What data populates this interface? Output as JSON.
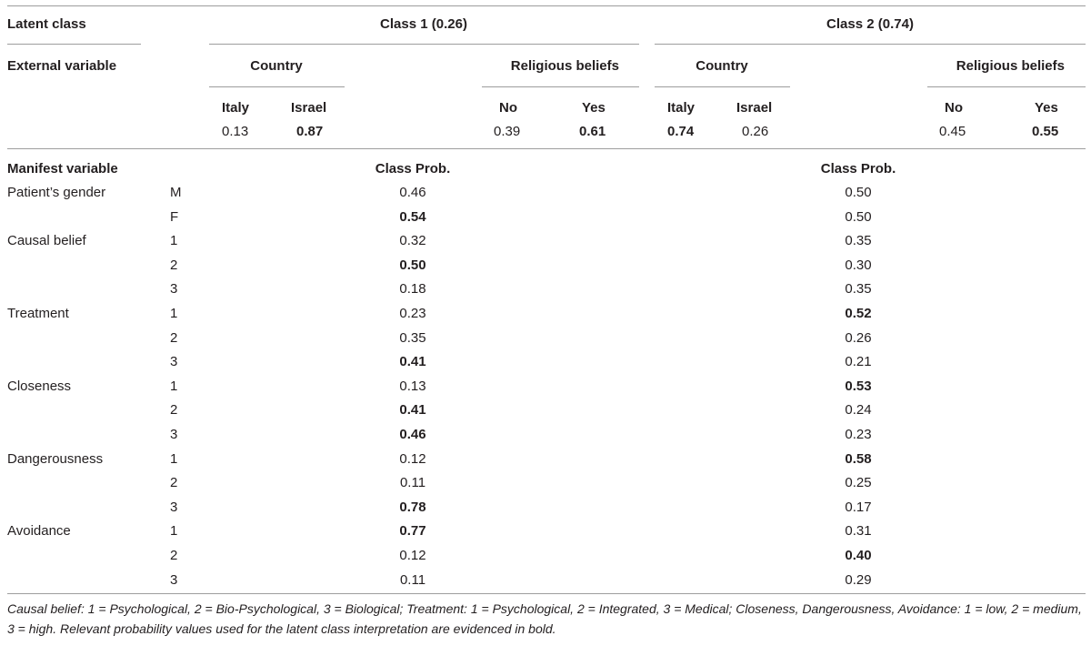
{
  "header": {
    "latent_class_label": "Latent class",
    "class1_label": "Class 1 (0.26)",
    "class2_label": "Class 2 (0.74)",
    "external_variable_label": "External variable",
    "country_label": "Country",
    "religious_label": "Religious beliefs",
    "italy": "Italy",
    "israel": "Israel",
    "no": "No",
    "yes": "Yes"
  },
  "external": {
    "class1": {
      "italy": "0.13",
      "israel": "0.87",
      "no": "0.39",
      "yes": "0.61"
    },
    "class2": {
      "italy": "0.74",
      "israel": "0.26",
      "no": "0.45",
      "yes": "0.55"
    }
  },
  "manifest": {
    "label": "Manifest variable",
    "class_prob_label": "Class Prob.",
    "rows": [
      {
        "variable": "Patient’s gender",
        "level": "M",
        "c1": "0.46",
        "c2": "0.50"
      },
      {
        "variable": "",
        "level": "F",
        "c1": "0.54",
        "c2": "0.50"
      },
      {
        "variable": "Causal belief",
        "level": "1",
        "c1": "0.32",
        "c2": "0.35"
      },
      {
        "variable": "",
        "level": "2",
        "c1": "0.50",
        "c2": "0.30"
      },
      {
        "variable": "",
        "level": "3",
        "c1": "0.18",
        "c2": "0.35"
      },
      {
        "variable": "Treatment",
        "level": "1",
        "c1": "0.23",
        "c2": "0.52"
      },
      {
        "variable": "",
        "level": "2",
        "c1": "0.35",
        "c2": "0.26"
      },
      {
        "variable": "",
        "level": "3",
        "c1": "0.41",
        "c2": "0.21"
      },
      {
        "variable": "Closeness",
        "level": "1",
        "c1": "0.13",
        "c2": "0.53"
      },
      {
        "variable": "",
        "level": "2",
        "c1": "0.41",
        "c2": "0.24"
      },
      {
        "variable": "",
        "level": "3",
        "c1": "0.46",
        "c2": "0.23"
      },
      {
        "variable": "Dangerousness",
        "level": "1",
        "c1": "0.12",
        "c2": "0.58"
      },
      {
        "variable": "",
        "level": "2",
        "c1": "0.11",
        "c2": "0.25"
      },
      {
        "variable": "",
        "level": "3",
        "c1": "0.78",
        "c2": "0.17"
      },
      {
        "variable": "Avoidance",
        "level": "1",
        "c1": "0.77",
        "c2": "0.31"
      },
      {
        "variable": "",
        "level": "2",
        "c1": "0.12",
        "c2": "0.40"
      },
      {
        "variable": "",
        "level": "3",
        "c1": "0.11",
        "c2": "0.29"
      }
    ]
  },
  "footnote": "Causal belief: 1 = Psychological, 2 = Bio-Psychological, 3 = Biological; Treatment: 1 = Psychological, 2 = Integrated, 3 = Medical; Closeness, Dangerousness, Avoidance: 1 = low, 2 = medium, 3 = high. Relevant probability values used for the latent class interpretation are evidenced in bold."
}
